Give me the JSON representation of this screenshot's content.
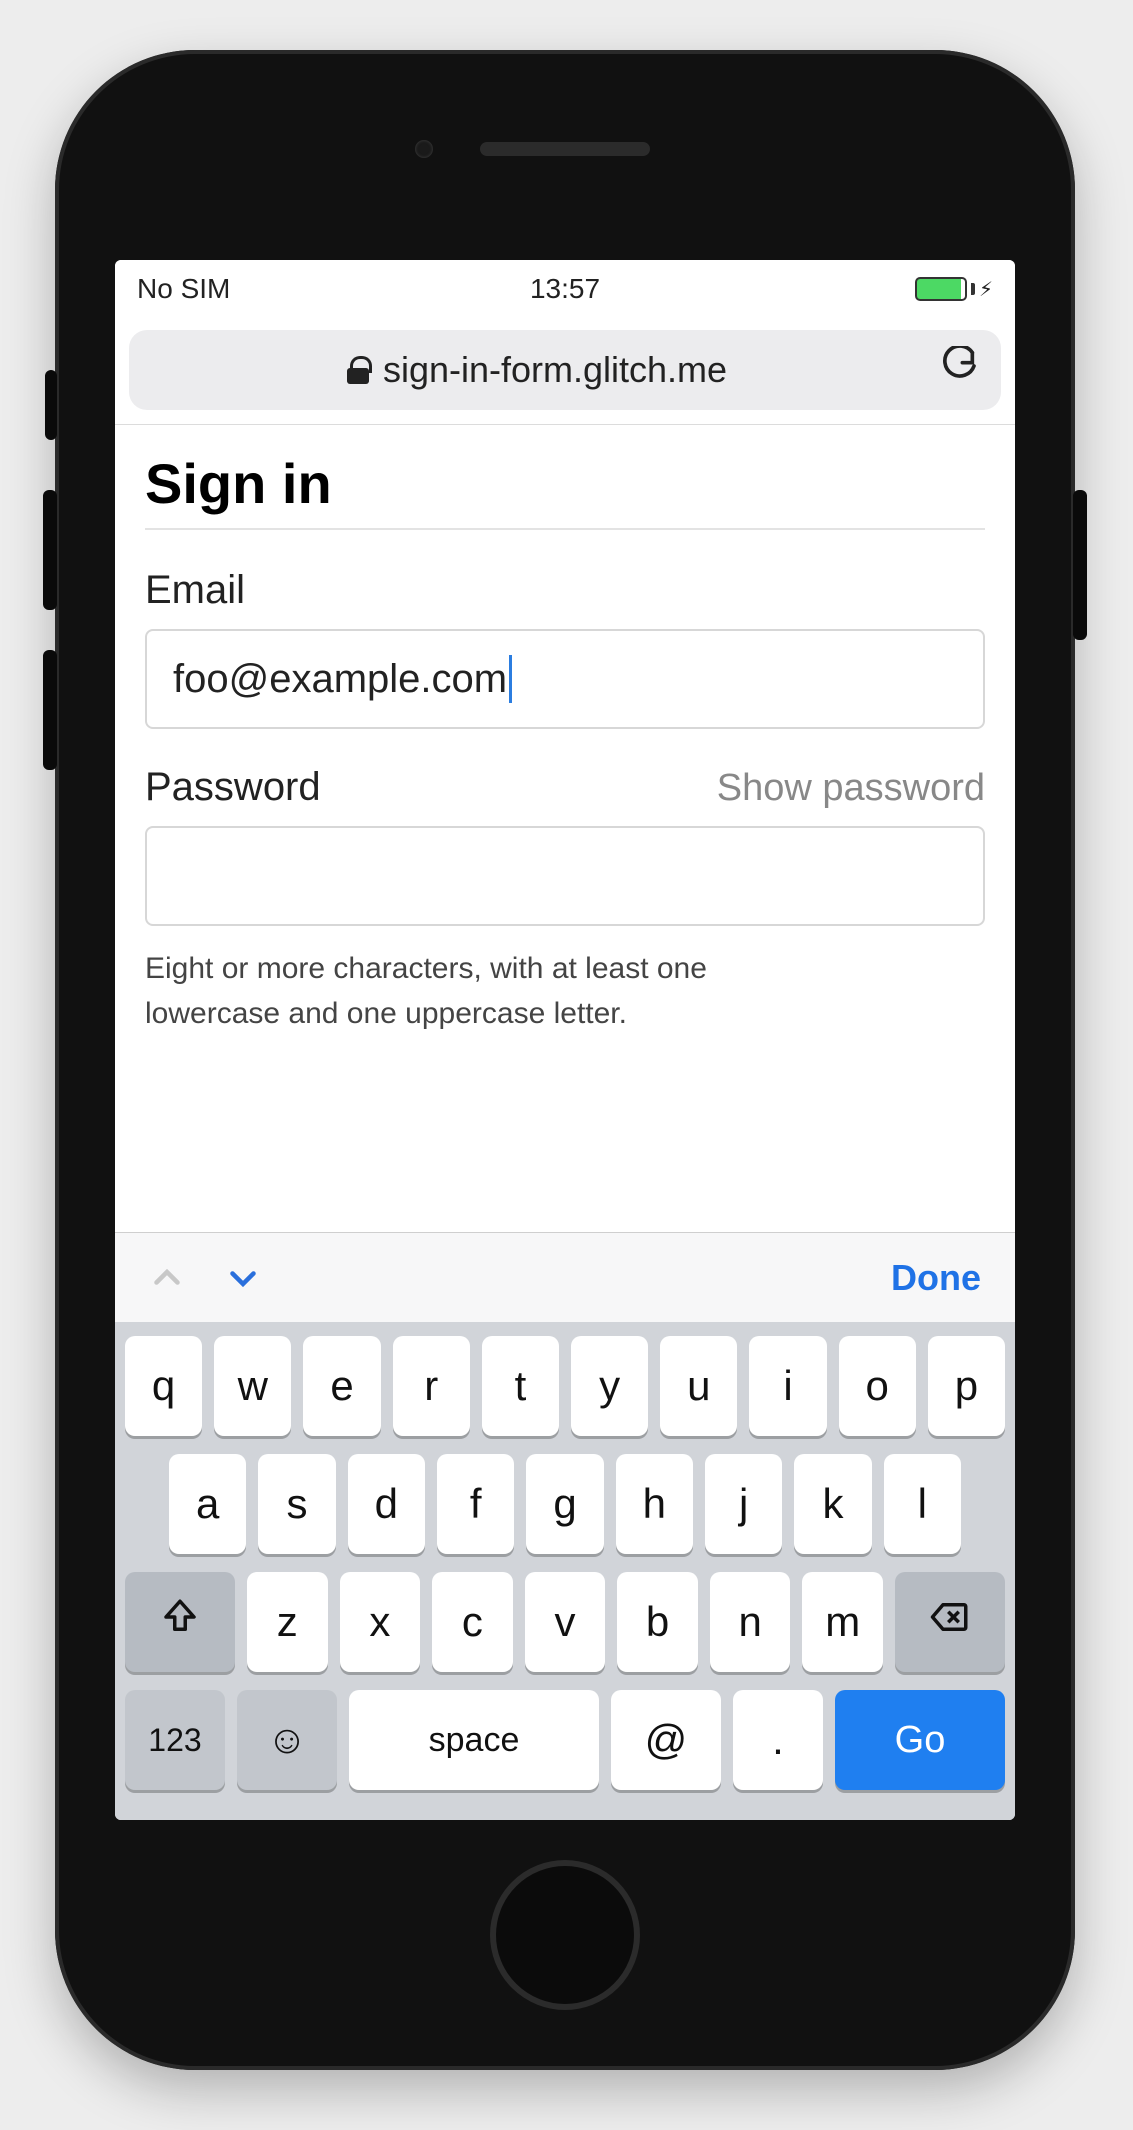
{
  "status": {
    "carrier": "No SIM",
    "time": "13:57"
  },
  "addressbar": {
    "url": "sign-in-form.glitch.me"
  },
  "page": {
    "title": "Sign in",
    "email_label": "Email",
    "email_value": "foo@example.com",
    "password_label": "Password",
    "show_password": "Show password",
    "password_value": "",
    "hint": "Eight or more characters, with at least one lowercase and one uppercase letter."
  },
  "kb_accessory": {
    "done": "Done"
  },
  "keyboard": {
    "row1": [
      "q",
      "w",
      "e",
      "r",
      "t",
      "y",
      "u",
      "i",
      "o",
      "p"
    ],
    "row2": [
      "a",
      "s",
      "d",
      "f",
      "g",
      "h",
      "j",
      "k",
      "l"
    ],
    "row3": [
      "z",
      "x",
      "c",
      "v",
      "b",
      "n",
      "m"
    ],
    "k123": "123",
    "space": "space",
    "at": "@",
    "dot": ".",
    "go": "Go"
  }
}
